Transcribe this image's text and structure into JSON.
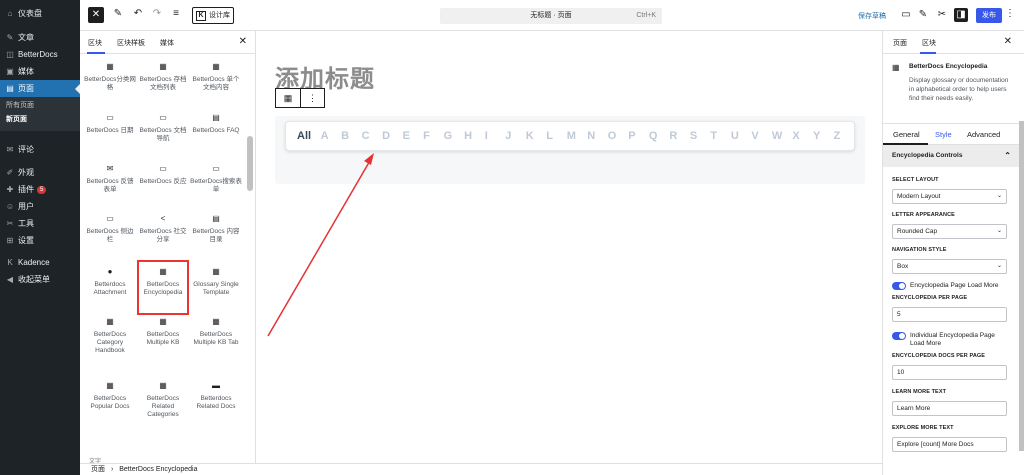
{
  "admin_menu": {
    "items": [
      {
        "icon": "⌂",
        "label": "仪表盘"
      },
      {
        "icon": "✎",
        "label": "文章"
      },
      {
        "icon": "◫",
        "label": "BetterDocs"
      },
      {
        "icon": "▣",
        "label": "媒体"
      },
      {
        "icon": "▤",
        "label": "页面"
      }
    ],
    "submenu": [
      "所有页面",
      "新页面"
    ],
    "items2": [
      {
        "icon": "✉",
        "label": "评论"
      },
      {
        "icon": "✐",
        "label": "外观"
      },
      {
        "icon": "✚",
        "label": "插件",
        "badge": "5"
      },
      {
        "icon": "☺",
        "label": "用户"
      },
      {
        "icon": "✂",
        "label": "工具"
      },
      {
        "icon": "⊞",
        "label": "设置"
      }
    ],
    "items3": [
      {
        "icon": "K",
        "label": "Kadence"
      },
      {
        "icon": "◀",
        "label": "收起菜单"
      }
    ]
  },
  "toolbar": {
    "pattern_label": "设计库",
    "doc_title": "无标题 · 页面",
    "shortcut": "Ctrl+K",
    "save_draft": "保存草稿",
    "publish": "发布"
  },
  "inserter": {
    "tabs": [
      "区块",
      "区块样板",
      "媒体"
    ],
    "blocks": [
      {
        "label": "BetterDocs分类网格",
        "icon": "▦"
      },
      {
        "label": "BetterDocs 存档文档列表",
        "icon": "▦"
      },
      {
        "label": "BetterDocs 单个文档内容",
        "icon": "▦"
      },
      {
        "label": "BetterDocs 日期",
        "icon": "▭"
      },
      {
        "label": "BetterDocs 文档导航",
        "icon": "▭"
      },
      {
        "label": "BetterDocs FAQ",
        "icon": "▤"
      },
      {
        "label": "BetterDocs 反馈表单",
        "icon": "✉"
      },
      {
        "label": "BetterDocs 反应",
        "icon": "▭"
      },
      {
        "label": "BetterDocs搜索表单",
        "icon": "▭"
      },
      {
        "label": "BetterDocs 侧边栏",
        "icon": "▭"
      },
      {
        "label": "BetterDocs 社交分享",
        "icon": "<"
      },
      {
        "label": "BetterDocs 内容目录",
        "icon": "▤"
      },
      {
        "label": "Betterdocs Attachment",
        "icon": "●"
      },
      {
        "label": "BetterDocs Encyclopedia",
        "icon": "▦"
      },
      {
        "label": "Glossary Single Template",
        "icon": "▦"
      },
      {
        "label": "BetterDocs Category Handbook",
        "icon": "▦"
      },
      {
        "label": "BetterDocs Multiple KB",
        "icon": "▦"
      },
      {
        "label": "BetterDocs Multiple KB Tab",
        "icon": "▦"
      },
      {
        "label": "BetterDocs Popular Docs",
        "icon": "▦"
      },
      {
        "label": "BetterDocs Related Categories",
        "icon": "▦"
      },
      {
        "label": "Betterdocs Related Docs",
        "icon": "▬"
      }
    ],
    "category_label": "文字"
  },
  "canvas": {
    "title": "添加标题",
    "letters": [
      "All",
      "A",
      "B",
      "C",
      "D",
      "E",
      "F",
      "G",
      "H",
      "I",
      "J",
      "K",
      "L",
      "M",
      "N",
      "O",
      "P",
      "Q",
      "R",
      "S",
      "T",
      "U",
      "V",
      "W",
      "X",
      "Y",
      "Z"
    ]
  },
  "settings": {
    "tabs": [
      "页面",
      "区块"
    ],
    "block_name": "BetterDocs Encyclopedia",
    "block_desc": "Display glossary or documentation in alphabetical order to help users find their needs easily.",
    "sub_tabs": [
      "General",
      "Style",
      "Advanced"
    ],
    "panel_title": "Encyclopedia Controls",
    "select_layout_label": "SELECT LAYOUT",
    "select_layout_value": "Modern Layout",
    "letter_appearance_label": "LETTER APPEARANCE",
    "letter_appearance_value": "Rounded Cap",
    "navigation_style_label": "NAVIGATION STYLE",
    "navigation_style_value": "Box",
    "toggle1_label": "Encyclopedia Page Load More",
    "per_page_label": "ENCYCLOPEDIA PER PAGE",
    "per_page_value": "5",
    "toggle2_label": "Individual Encyclopedia Page Load More",
    "docs_per_page_label": "ENCYCLOPEDIA DOCS PER PAGE",
    "docs_per_page_value": "10",
    "learn_more_label": "LEARN MORE TEXT",
    "learn_more_value": "Learn More",
    "explore_more_label": "EXPLORE MORE TEXT",
    "explore_more_value": "Explore [count] More Docs"
  },
  "footer": {
    "crumb_root": "页面",
    "crumb_current": "BetterDocs Encyclopedia"
  },
  "colors": {
    "accent": "#3858e9",
    "admin_bg": "#1d2327",
    "highlight": "#e33333"
  }
}
